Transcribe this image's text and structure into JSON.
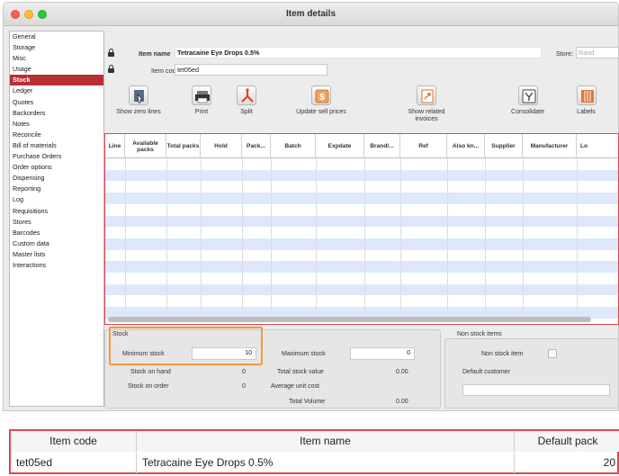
{
  "window": {
    "title": "Item details"
  },
  "sidebar": {
    "items": [
      {
        "label": "General"
      },
      {
        "label": "Storage"
      },
      {
        "label": "Misc"
      },
      {
        "label": "Usage"
      },
      {
        "label": "Stock",
        "active": true
      },
      {
        "label": "Ledger"
      },
      {
        "label": "Quotes"
      },
      {
        "label": "Backorders"
      },
      {
        "label": "Notes"
      },
      {
        "label": "Reconcile"
      },
      {
        "label": "Bill of materials"
      },
      {
        "label": "Purchase Orders"
      },
      {
        "label": "Order options"
      },
      {
        "label": "Dispensing"
      },
      {
        "label": "Reporting"
      },
      {
        "label": "Log"
      },
      {
        "label": "Requisitions"
      },
      {
        "label": "Stores"
      },
      {
        "label": "Barcodes"
      },
      {
        "label": "Custom data"
      },
      {
        "label": "Master lists"
      },
      {
        "label": "Interactions"
      }
    ]
  },
  "header": {
    "item_name_label": "Item name",
    "item_name_value": "Tetracaine Eye Drops 0.5%",
    "item_code_label": "Item code",
    "item_code_value": "tet05ed",
    "store_label": "Store:",
    "store_value": "Rand"
  },
  "toolbar": {
    "buttons": [
      {
        "label": "Show zero lines",
        "icon": "show-zero-lines-icon"
      },
      {
        "label": "Print",
        "icon": "printer-icon"
      },
      {
        "label": "Split",
        "icon": "split-icon"
      },
      {
        "label": "Update sell prices",
        "icon": "update-prices-icon"
      },
      {
        "label": "Show related invoices",
        "icon": "related-invoices-icon"
      },
      {
        "label": "Consolidate",
        "icon": "consolidate-icon"
      },
      {
        "label": "Labels",
        "icon": "labels-icon"
      }
    ]
  },
  "table": {
    "columns": [
      "Line",
      "Available packs",
      "Total packs",
      "Hold",
      "Pack...",
      "Batch",
      "Expdate",
      "Brand/...",
      "Ref",
      "Also kn...",
      "Supplier",
      "Manufacturer",
      "Lo"
    ]
  },
  "stock": {
    "title": "Stock",
    "minimum_stock_label": "Minimum stock",
    "minimum_stock_value": "10",
    "maximum_stock_label": "Maximum stock",
    "maximum_stock_value": "0",
    "stock_on_hand_label": "Stock on hand",
    "stock_on_hand_value": "0",
    "total_stock_value_label": "Total stock value",
    "total_stock_value_value": "0.00",
    "stock_on_order_label": "Stock on order",
    "stock_on_order_value": "0",
    "average_unit_cost_label": "Average unit cost",
    "total_volume_label": "Total Volume",
    "total_volume_value": "0.00"
  },
  "non_stock": {
    "title": "Non stock items",
    "non_stock_item_label": "Non stock item",
    "default_customer_label": "Default customer"
  },
  "sheet": {
    "headers": [
      "Item code",
      "Item name",
      "Default pack"
    ],
    "row": [
      "tet05ed",
      "Tetracaine Eye Drops 0.5%",
      "20"
    ]
  },
  "colors": {
    "accent": "#b72e33",
    "highlight": "#f39a3a",
    "table_outline": "#e0474f",
    "row_alt": "#dfe7fb"
  }
}
